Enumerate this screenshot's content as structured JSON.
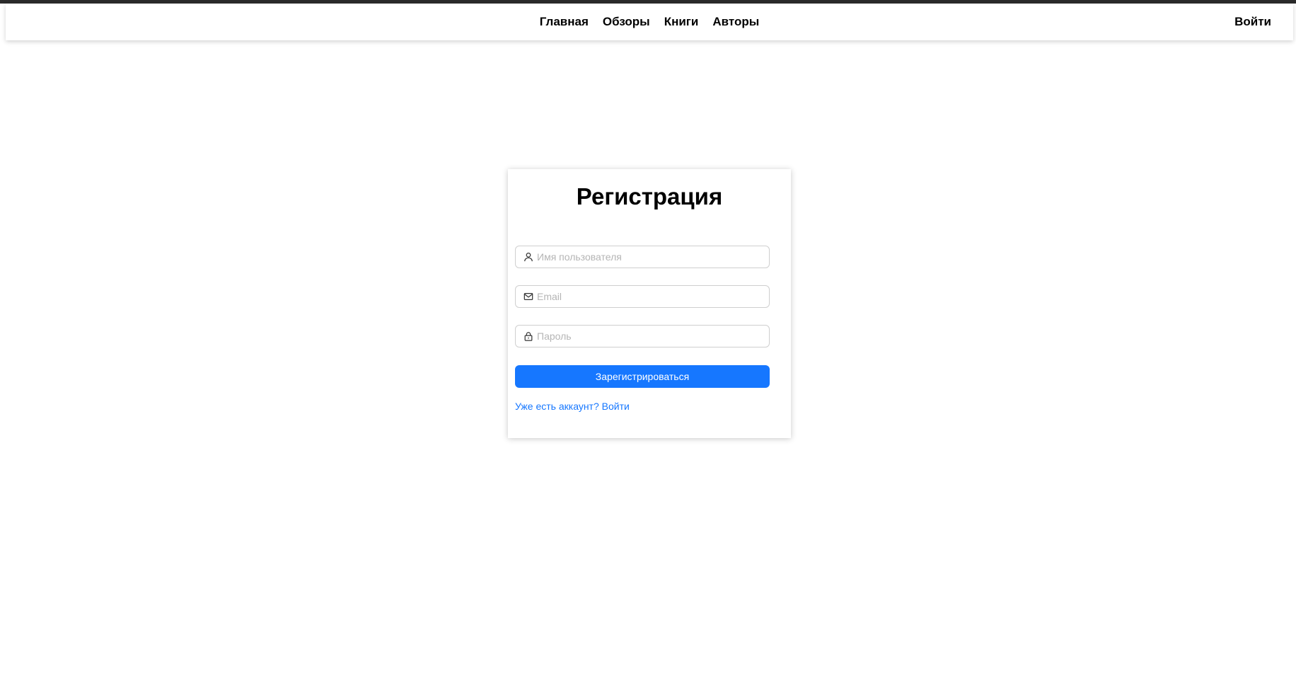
{
  "nav": {
    "links": [
      "Главная",
      "Обзоры",
      "Книги",
      "Авторы"
    ],
    "login": "Войти"
  },
  "form": {
    "title": "Регистрация",
    "username_placeholder": "Имя пользователя",
    "email_placeholder": "Email",
    "password_placeholder": "Пароль",
    "submit_label": "Зарегистрироваться",
    "signin_link": "Уже есть аккаунт? Войти"
  },
  "icons": {
    "username": "user-icon",
    "email": "mail-icon",
    "password": "lock-icon"
  },
  "colors": {
    "primary": "#1677ff",
    "text": "#000000",
    "placeholder": "#b5b5b5"
  }
}
